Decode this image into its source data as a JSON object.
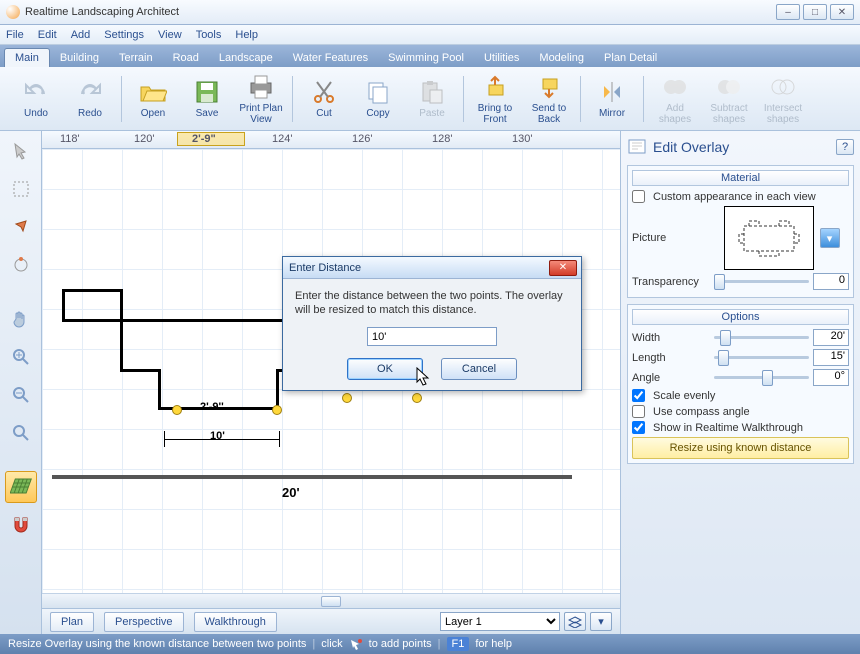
{
  "app": {
    "title": "Realtime Landscaping Architect"
  },
  "menu": {
    "items": [
      "File",
      "Edit",
      "Add",
      "Settings",
      "View",
      "Tools",
      "Help"
    ]
  },
  "ribbon_tabs": [
    "Main",
    "Building",
    "Terrain",
    "Road",
    "Landscape",
    "Water Features",
    "Swimming Pool",
    "Utilities",
    "Modeling",
    "Plan Detail"
  ],
  "ribbon_active": 0,
  "toolbar": {
    "undo": "Undo",
    "redo": "Redo",
    "open": "Open",
    "save": "Save",
    "printplan": "Print Plan\nView",
    "cut": "Cut",
    "copy": "Copy",
    "paste": "Paste",
    "bringfront": "Bring to\nFront",
    "sendback": "Send to\nBack",
    "mirror": "Mirror",
    "addshapes": "Add\nshapes",
    "subtract": "Subtract\nshapes",
    "intersect": "Intersect\nshapes"
  },
  "ruler": {
    "marks": [
      "118'",
      "120'",
      "2'-9\"",
      "124'",
      "126'",
      "128'",
      "130'"
    ],
    "highlight_label": "2'-9\""
  },
  "canvas": {
    "dim_small": "2'-9''",
    "dim_mid": "10'",
    "dim_large": "20'"
  },
  "view_tabs": {
    "plan": "Plan",
    "perspective": "Perspective",
    "walkthrough": "Walkthrough"
  },
  "layer_select": "Layer 1",
  "panel": {
    "title": "Edit Overlay",
    "sections": {
      "material": "Material",
      "options": "Options"
    },
    "custom_appearance": "Custom appearance in each view",
    "picture_label": "Picture",
    "transparency_label": "Transparency",
    "transparency_value": "0",
    "width_label": "Width",
    "width_value": "20'",
    "length_label": "Length",
    "length_value": "15'",
    "angle_label": "Angle",
    "angle_value": "0°",
    "scale_evenly": "Scale evenly",
    "compass": "Use compass angle",
    "show_walkthrough": "Show in Realtime Walkthrough",
    "resize_btn": "Resize using known distance"
  },
  "dialog": {
    "title": "Enter Distance",
    "body": "Enter the distance between the two points. The overlay will be resized to match this distance.",
    "input_value": "10'",
    "ok": "OK",
    "cancel": "Cancel"
  },
  "status": {
    "msg": "Resize Overlay using the known distance between two points",
    "hint_click": "click",
    "hint_add": "to add points",
    "hint_key": "F1",
    "hint_help": "for help"
  }
}
